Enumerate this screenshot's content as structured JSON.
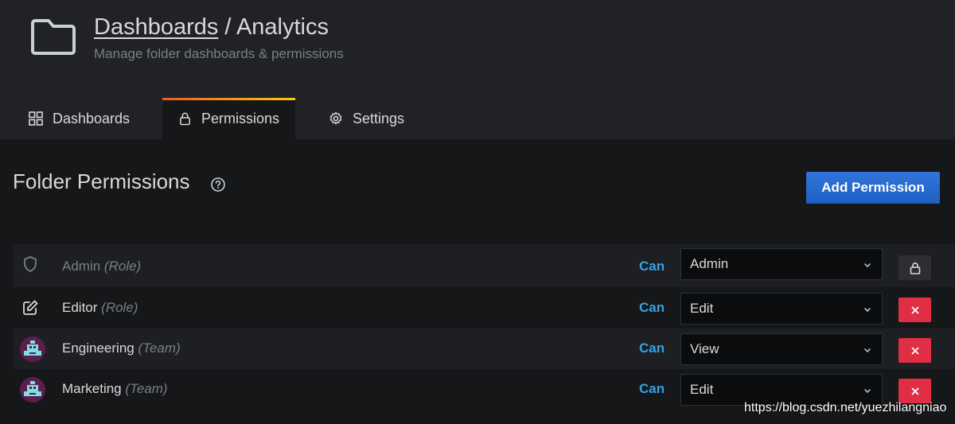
{
  "header": {
    "breadcrumb_link": "Dashboards",
    "separator": " / ",
    "folder_name": "Analytics",
    "subtitle": "Manage folder dashboards & permissions",
    "icon": "folder-icon"
  },
  "tabs": [
    {
      "label": "Dashboards",
      "icon": "grid-icon",
      "active": false
    },
    {
      "label": "Permissions",
      "icon": "lock-icon",
      "active": true
    },
    {
      "label": "Settings",
      "icon": "gear-icon",
      "active": false
    }
  ],
  "section": {
    "title": "Folder Permissions",
    "help_icon": "help-icon",
    "add_button": "Add Permission"
  },
  "permissions": [
    {
      "name": "Admin",
      "kind": "(Role)",
      "can": "Can",
      "level": "Admin",
      "icon": "shield-icon",
      "locked": true
    },
    {
      "name": "Editor",
      "kind": "(Role)",
      "can": "Can",
      "level": "Edit",
      "icon": "edit-icon",
      "locked": false
    },
    {
      "name": "Engineering",
      "kind": "(Team)",
      "can": "Can",
      "level": "View",
      "icon": "team-avatar",
      "locked": false
    },
    {
      "name": "Marketing",
      "kind": "(Team)",
      "can": "Can",
      "level": "Edit",
      "icon": "team-avatar",
      "locked": false
    }
  ],
  "watermark": "https://blog.csdn.net/yuezhilangniao",
  "colors": {
    "background": "#161719",
    "header": "#202226",
    "accent_blue": "#1f60c4",
    "can_text": "#33a2e5",
    "delete_red": "#e02f44"
  }
}
